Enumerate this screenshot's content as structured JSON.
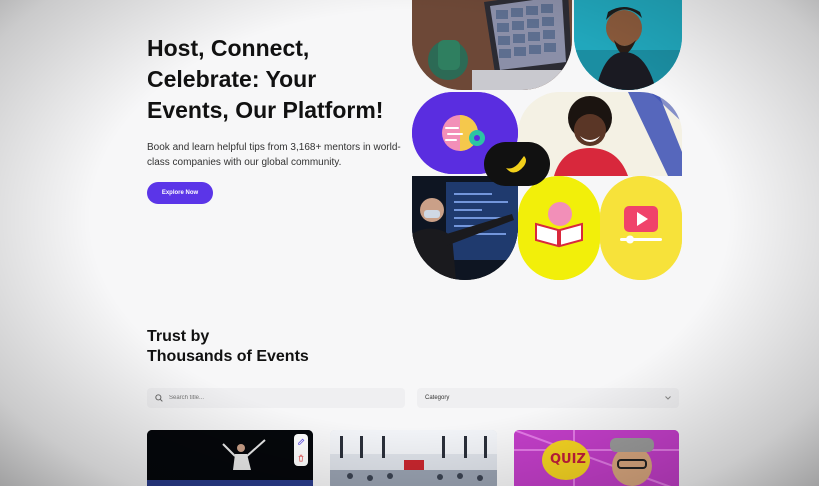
{
  "hero": {
    "title_line1": "Host, Connect,",
    "title_line2": "Celebrate: Your",
    "title_line3": "Events, Our Platform!",
    "subtitle": "Book and learn helpful tips from 3,168+ mentors in world-class companies with our global community.",
    "cta_label": "Explore Now"
  },
  "section": {
    "title_line1": "Trust by",
    "title_line2": "Thousands of Events"
  },
  "filters": {
    "search_placeholder": "Search title...",
    "category_label": "Category"
  },
  "cards": [
    {
      "image": "badminton-player-photo"
    },
    {
      "image": "conference-hall-photo"
    },
    {
      "image": "quiz-event-poster",
      "poster_text": "QUIZ"
    }
  ],
  "colors": {
    "accent": "#5b35e8",
    "yellow": "#f2ef0a",
    "yellow_soft": "#f7e23a",
    "purple": "#5a2de0",
    "teal": "#1fa3b8",
    "magenta": "#c33ec9"
  }
}
